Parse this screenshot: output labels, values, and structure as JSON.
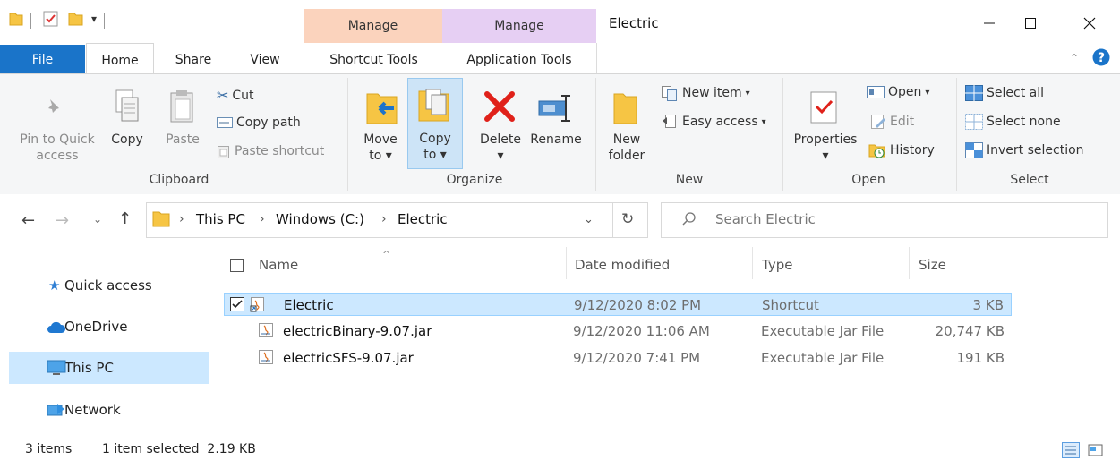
{
  "window": {
    "title": "Electric",
    "context_tab_shortcut": "Manage",
    "context_tab_app": "Manage"
  },
  "tabs": {
    "file": "File",
    "home": "Home",
    "share": "Share",
    "view": "View",
    "shortcut_tools": "Shortcut Tools",
    "application_tools": "Application Tools"
  },
  "ribbon": {
    "clipboard": {
      "label": "Clipboard",
      "pin_line1": "Pin to Quick",
      "pin_line2": "access",
      "copy": "Copy",
      "paste": "Paste",
      "cut": "Cut",
      "copy_path": "Copy path",
      "paste_shortcut": "Paste shortcut"
    },
    "organize": {
      "label": "Organize",
      "move_line1": "Move",
      "move_line2": "to",
      "copy_line1": "Copy",
      "copy_line2": "to",
      "delete": "Delete",
      "rename": "Rename"
    },
    "new": {
      "label": "New",
      "new_folder_line1": "New",
      "new_folder_line2": "folder",
      "new_item": "New item",
      "easy_access": "Easy access"
    },
    "open": {
      "label": "Open",
      "properties": "Properties",
      "open": "Open",
      "edit": "Edit",
      "history": "History"
    },
    "select": {
      "label": "Select",
      "select_all": "Select all",
      "select_none": "Select none",
      "invert_selection": "Invert selection"
    }
  },
  "address": {
    "crumbs": [
      "This PC",
      "Windows (C:)",
      "Electric"
    ],
    "search_placeholder": "Search Electric"
  },
  "nav": {
    "quick_access": "Quick access",
    "onedrive": "OneDrive",
    "this_pc": "This PC",
    "network": "Network"
  },
  "columns": {
    "name": "Name",
    "date_modified": "Date modified",
    "type": "Type",
    "size": "Size"
  },
  "files": [
    {
      "name": "Electric",
      "date": "9/12/2020 8:02 PM",
      "type": "Shortcut",
      "size": "3 KB",
      "selected": true
    },
    {
      "name": "electricBinary-9.07.jar",
      "date": "9/12/2020 11:06 AM",
      "type": "Executable Jar File",
      "size": "20,747 KB",
      "selected": false
    },
    {
      "name": "electricSFS-9.07.jar",
      "date": "9/12/2020 7:41 PM",
      "type": "Executable Jar File",
      "size": "191 KB",
      "selected": false
    }
  ],
  "status": {
    "items": "3 items",
    "selected": "1 item selected  2.19 KB"
  },
  "colors": {
    "file_tab": "#1a74c9",
    "shortcut_tools_ctx": "#fbd3bd",
    "app_tools_ctx": "#e6cff3",
    "selection": "#cce8ff"
  }
}
